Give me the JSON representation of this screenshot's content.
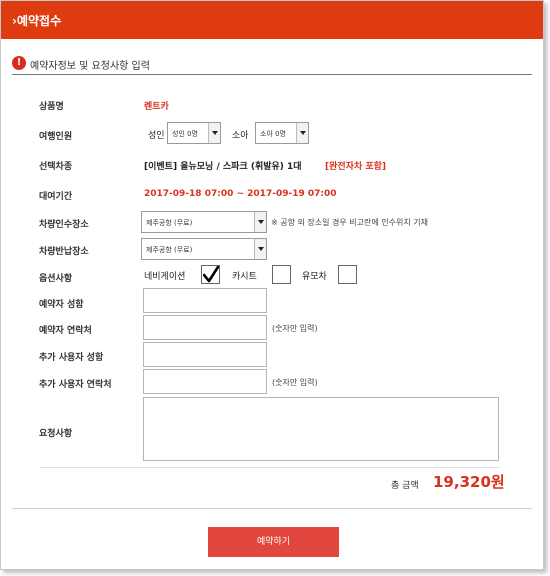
{
  "header": {
    "title": "›예약접수"
  },
  "section": {
    "title": "예약자정보 및 요청사항 입력",
    "warn_icon": "!"
  },
  "form": {
    "product": {
      "label": "상품명",
      "value": "렌트카"
    },
    "people": {
      "label": "여행인원",
      "adult_label": "성인",
      "adult_value": "성인 0명",
      "child_label": "소아",
      "child_value": "소아 0명"
    },
    "vehicle": {
      "label": "선택차종",
      "value": "[이벤트] 올뉴모닝 / 스파크 (휘발유) 1대",
      "extra": "[완전자차 포함]"
    },
    "period": {
      "label": "대여기간",
      "value": "2017-09-18 07:00 ~ 2017-09-19 07:00"
    },
    "pickup": {
      "label": "차량인수장소",
      "value": "제주공항 (무료)",
      "note": "※ 공항 외 장소일 경우 비고란에 인수위치 기재"
    },
    "return_place": {
      "label": "차량반납장소",
      "value": "제주공항 (무료)"
    },
    "options": {
      "label": "옵션사항",
      "nav": "네비게이션",
      "nav_checked": true,
      "seat": "카시트",
      "seat_checked": false,
      "stroller": "유모차",
      "stroller_checked": false
    },
    "name": {
      "label": "예약자 성함",
      "value": ""
    },
    "phone": {
      "label": "예약자 연락처",
      "value": "",
      "hint": "(숫자만 입력)"
    },
    "extra_name": {
      "label": "추가 사용자 성함",
      "value": ""
    },
    "extra_phone": {
      "label": "추가 사용자 연락처",
      "value": "",
      "hint": "(숫자만 입력)"
    },
    "request": {
      "label": "요청사항",
      "value": ""
    }
  },
  "total": {
    "label": "총 금액",
    "value": "19,320원"
  },
  "submit_label": "예약하기"
}
